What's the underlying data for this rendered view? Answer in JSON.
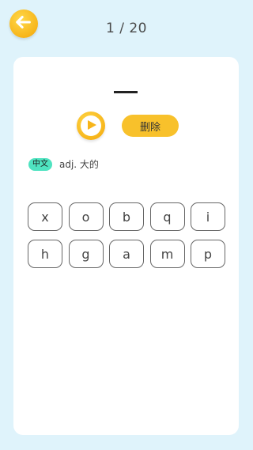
{
  "header": {
    "progress": "1 / 20",
    "back_icon": "arrow-left-icon"
  },
  "card": {
    "play_icon": "play-icon",
    "delete_label": "删除",
    "meaning": {
      "lang_label": "中文",
      "definition": "adj. 大的"
    },
    "keys_row1": [
      "x",
      "o",
      "b",
      "q",
      "i"
    ],
    "keys_row2": [
      "h",
      "g",
      "a",
      "m",
      "p"
    ]
  },
  "colors": {
    "background": "#dff3fb",
    "accent": "#f8c12b",
    "badge": "#4fe3c0"
  }
}
